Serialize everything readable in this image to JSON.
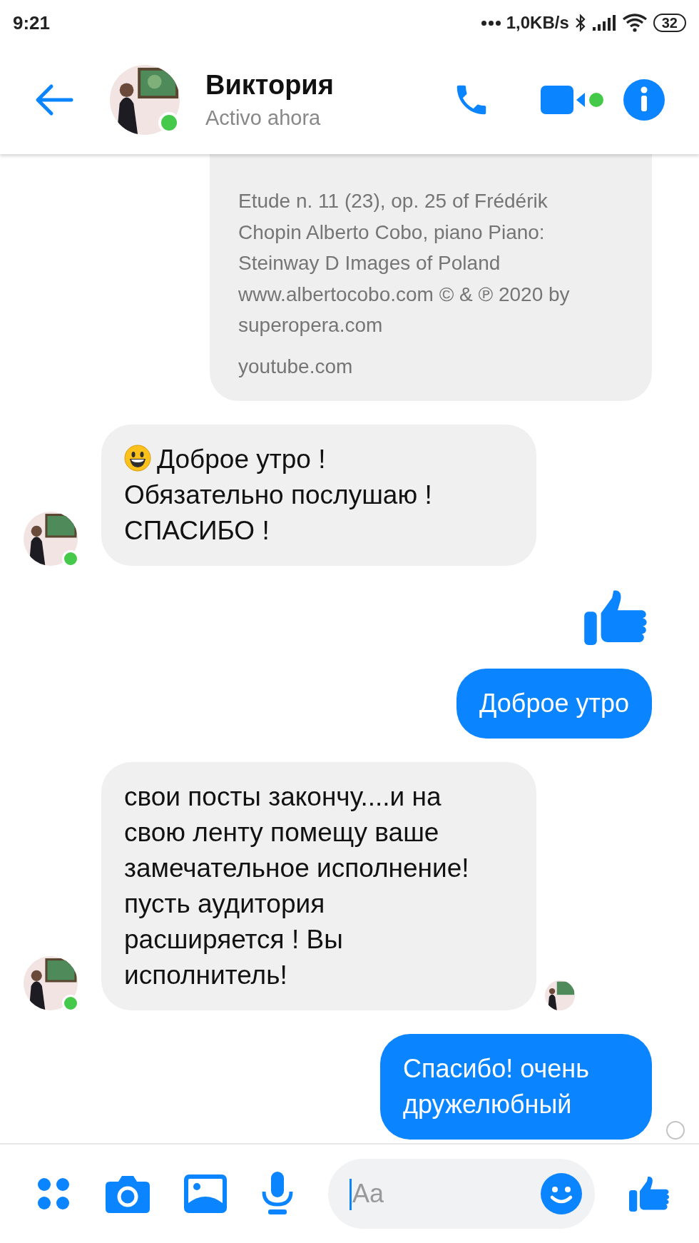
{
  "status_bar": {
    "time": "9:21",
    "network_speed": "1,0KB/s",
    "battery": "32"
  },
  "header": {
    "contact_name": "Виктория",
    "status": "Activo ahora",
    "online": true,
    "video_call_active": true
  },
  "messages": [
    {
      "kind": "link_card",
      "description": "Etude n. 11 (23), op. 25 of Frédérik Chopin Alberto Cobo, piano Piano: Steinway D Images of Poland www.albertocobo.com © & ℗ 2020 by superopera.com",
      "domain": "youtube.com",
      "outgoing": true,
      "avatar": false,
      "seen": false,
      "pending": false
    },
    {
      "kind": "text",
      "outgoing": false,
      "emoji": true,
      "text": "Доброе утро ! Обязательно послушаю ! СПАСИБО !",
      "avatar": true,
      "seen": false,
      "pending": false
    },
    {
      "kind": "like",
      "outgoing": true,
      "avatar": false,
      "seen": false,
      "pending": false
    },
    {
      "kind": "text",
      "outgoing": true,
      "emoji": false,
      "text": "Доброе утро",
      "avatar": false,
      "seen": false,
      "pending": false
    },
    {
      "kind": "text",
      "outgoing": false,
      "emoji": false,
      "text": "свои посты закончу....и на свою ленту помещу ваше замечательное исполнение! пусть аудитория расширяется ! Вы исполнитель!",
      "avatar": true,
      "seen": true,
      "pending": false
    },
    {
      "kind": "text",
      "outgoing": true,
      "emoji": false,
      "text": "Спасибо! очень дружелюбный",
      "avatar": false,
      "seen": false,
      "pending": true
    }
  ],
  "composer": {
    "placeholder": "Aa"
  }
}
